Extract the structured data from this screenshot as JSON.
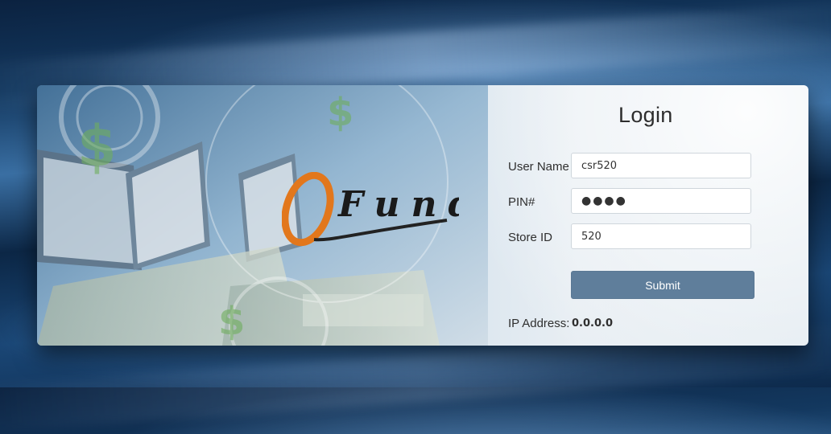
{
  "logo": {
    "brand_text": "Fund"
  },
  "login": {
    "title": "Login",
    "username_label": "User Name",
    "username_value": "csr520",
    "pin_label": "PIN#",
    "pin_value_masked": "●●●●",
    "store_label": "Store ID",
    "store_value": "520",
    "submit_label": "Submit",
    "ip_label": "IP Address:",
    "ip_value": "0.0.0.0"
  },
  "colors": {
    "submit_bg": "#5f7e9b",
    "logo_orange": "#e2771c",
    "text_dark": "#2f2f2f"
  }
}
